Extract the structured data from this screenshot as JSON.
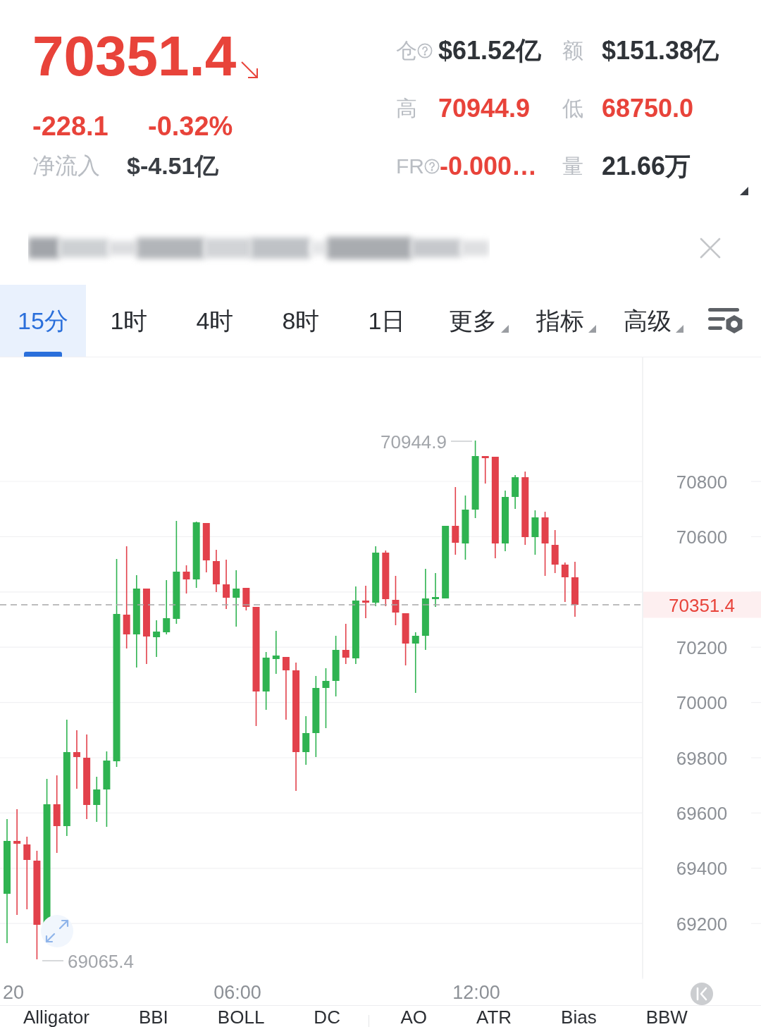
{
  "quote": {
    "price": "70351.4",
    "falling": true,
    "change": "-228.1",
    "change_percent": "-0.32%",
    "net_inflow_label": "净流入",
    "net_inflow": "$-4.51亿"
  },
  "stats": [
    {
      "label": "仓",
      "help": true,
      "value": "$61.52亿",
      "color": "#2f3338"
    },
    {
      "label": "额",
      "help": false,
      "value": "$151.38亿",
      "color": "#2f3338"
    },
    {
      "label": "高",
      "help": false,
      "value": "70944.9",
      "color": "#e8433a"
    },
    {
      "label": "低",
      "help": false,
      "value": "68750.0",
      "color": "#e8433a"
    },
    {
      "label": "FR",
      "help": true,
      "value": "-0.000…",
      "color": "#e8433a"
    },
    {
      "label": "量",
      "help": false,
      "value": "21.66万",
      "color": "#2f3338"
    }
  ],
  "tabs": [
    {
      "label": "15分",
      "kind": "interval",
      "selected": true
    },
    {
      "label": "1时",
      "kind": "interval",
      "selected": false
    },
    {
      "label": "4时",
      "kind": "interval",
      "selected": false
    },
    {
      "label": "8时",
      "kind": "interval",
      "selected": false
    },
    {
      "label": "1日",
      "kind": "interval",
      "selected": false
    },
    {
      "label": "更多",
      "kind": "menu",
      "selected": false
    },
    {
      "label": "指标",
      "kind": "menu",
      "selected": false
    },
    {
      "label": "高级",
      "kind": "menu",
      "selected": false
    }
  ],
  "chart": {
    "price_axis": [
      {
        "kind": "tick",
        "label": "70800"
      },
      {
        "kind": "tick",
        "label": "70600"
      },
      {
        "kind": "gridline"
      },
      {
        "kind": "tick",
        "label": "70200"
      },
      {
        "kind": "tick",
        "label": "70000"
      },
      {
        "kind": "tick",
        "label": "69800"
      },
      {
        "kind": "tick",
        "label": "69600"
      },
      {
        "kind": "tick",
        "label": "69400"
      },
      {
        "kind": "tick",
        "label": "69200"
      }
    ],
    "last_price": "70351.4",
    "high_marker": "70944.9",
    "low_marker": "69065.4",
    "time_axis": [
      "20",
      "06:00",
      "12:00"
    ]
  },
  "indicators": {
    "main": [
      "Alligator",
      "BBI",
      "BOLL",
      "DC"
    ],
    "sub": [
      "AO",
      "ATR",
      "Bias",
      "BBW"
    ]
  }
}
